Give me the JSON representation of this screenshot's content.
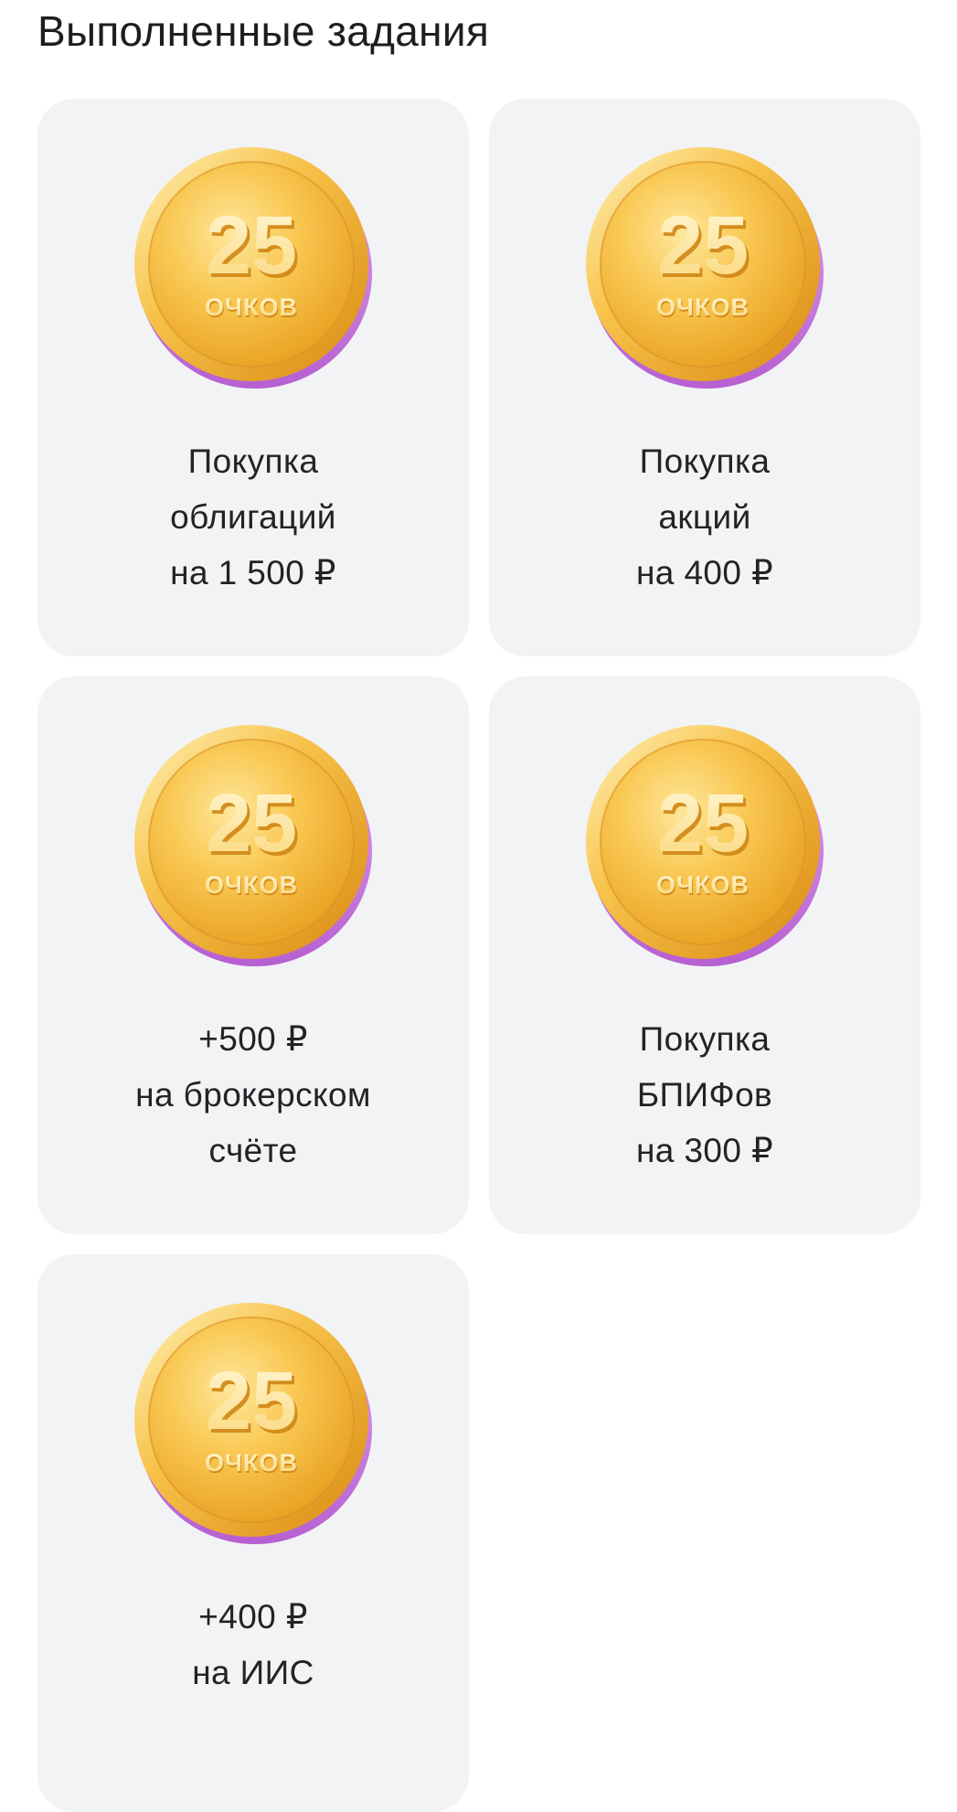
{
  "page": {
    "title": "Выполненные задания"
  },
  "coin": {
    "number": "25",
    "caption": "ОЧКОВ",
    "colors": {
      "gold_light": "#fde79a",
      "gold_mid": "#f6bc45",
      "gold_dark": "#e59a1d",
      "rim_shadow": "#c46cd8",
      "text_light": "#fff3c8",
      "text_dark": "#d98a12"
    }
  },
  "tasks": [
    {
      "lines": [
        "Покупка",
        "облигаций",
        "на 1 500 ₽"
      ]
    },
    {
      "lines": [
        "Покупка",
        "акций",
        "на 400 ₽"
      ]
    },
    {
      "lines": [
        "+500 ₽",
        "на брокерском",
        "счёте"
      ]
    },
    {
      "lines": [
        "Покупка",
        "БПИФов",
        "на 300 ₽"
      ]
    },
    {
      "lines": [
        "+400 ₽",
        "на ИИС"
      ]
    }
  ],
  "colors": {
    "background": "#ffffff",
    "card": "#f2f3f5",
    "text": "#232326"
  }
}
